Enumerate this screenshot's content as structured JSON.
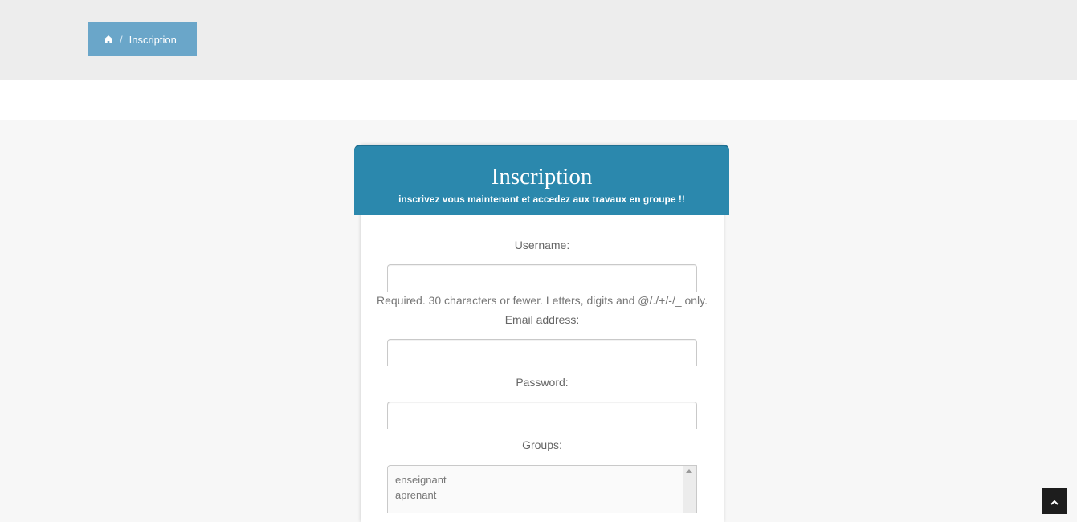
{
  "breadcrumb": {
    "home_icon": "home-icon",
    "separator": "/",
    "current": "Inscription"
  },
  "form": {
    "title": "Inscription",
    "subtitle": "inscrivez vous maintenant et accedez aux travaux en groupe !!",
    "username_label": "Username:",
    "username_help": "Required. 30 characters or fewer. Letters, digits and @/./+/-/_ only.",
    "email_label": "Email address:",
    "password_label": "Password:",
    "groups_label": "Groups:",
    "groups_options": [
      "enseignant",
      "aprenant"
    ]
  },
  "colors": {
    "header_bg": "#2b88ad",
    "breadcrumb_bg": "#6aa6c9",
    "top_band_bg": "#ededed",
    "page_bg": "#f7f7f7"
  },
  "back_to_top_icon": "chevron-up-icon"
}
